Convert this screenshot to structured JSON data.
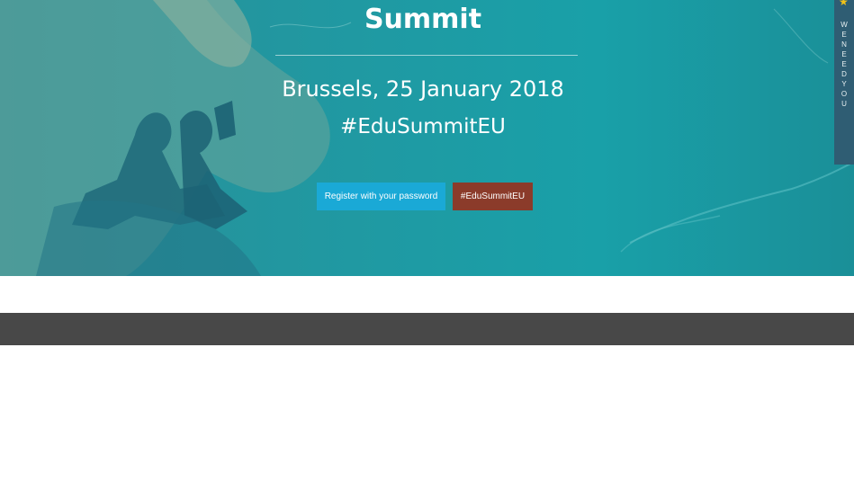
{
  "hero": {
    "title": "Summit",
    "date": "Brussels, 25 January 2018",
    "hashtag": "#EduSummitEU",
    "register_button": "Register with your password",
    "hashtag_button": "#EduSummitEU"
  },
  "side_tab": {
    "text": "WE NEED YOU"
  },
  "colors": {
    "hero_bg": "#1f9aa3",
    "register_button": "#1aa9d6",
    "hashtag_button": "#8b3b2a",
    "footer_bar": "#484848",
    "side_tab": "#2f5d73"
  }
}
